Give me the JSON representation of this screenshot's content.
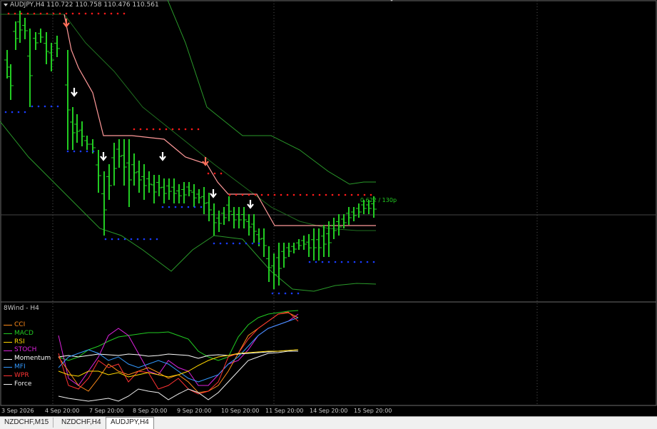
{
  "symbol_label": "AUDJPY,H4  110.722 110.758 110.476 110.561",
  "indicator_title": "8Wind - H4",
  "tp_label": "0.622 / 130p",
  "legend": [
    {
      "label": "CCI",
      "color": "#ff8c1a"
    },
    {
      "label": "MACD",
      "color": "#22cc22"
    },
    {
      "label": "RSI",
      "color": "#ffd700"
    },
    {
      "label": "STOCH",
      "color": "#dd22dd"
    },
    {
      "label": "Momentum",
      "color": "#ffffff"
    },
    {
      "label": "MFI",
      "color": "#3399ff"
    },
    {
      "label": "WPR",
      "color": "#ff3333"
    },
    {
      "label": "Force",
      "color": "#f0f0f0"
    }
  ],
  "x_axis": [
    "3 Sep 2026",
    "4 Sep 20:00",
    "7 Sep 20:00",
    "8 Sep 20:00",
    "9 Sep 20:00",
    "10 Sep 20:00",
    "11 Sep 20:00",
    "14 Sep 20:00",
    "15 Sep 20:00"
  ],
  "tabs": [
    {
      "label": "NZDCHF,M15",
      "active": false
    },
    {
      "label": "NZDCHF,H4",
      "active": false
    },
    {
      "label": "AUDJPY,H4",
      "active": true
    }
  ],
  "colors": {
    "bull": "#22cc22",
    "supertrend": "#ff9999",
    "upper_dots": "#ff1a1a",
    "lower_dots": "#1a3cff",
    "bands": "#2a9a2a",
    "grid": "#555555"
  }
}
